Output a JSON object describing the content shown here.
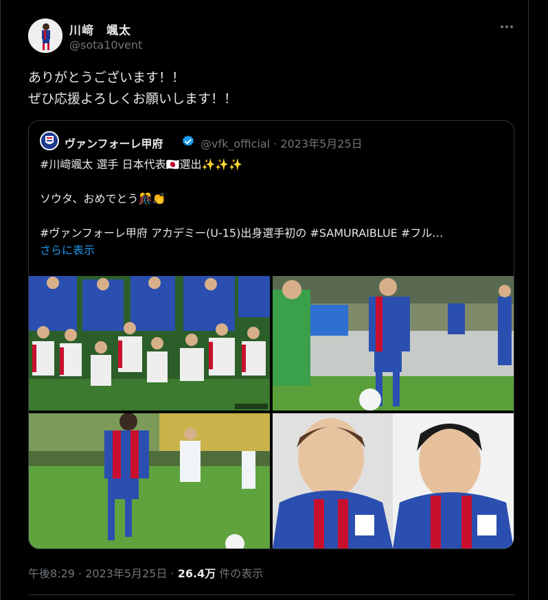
{
  "post": {
    "author_name": "川﨑　颯太",
    "author_handle": "@sota10vent",
    "more_icon": "more-icon",
    "lines": [
      "ありがとうございます！！",
      "ぜひ応援よろしくお願いします！！"
    ]
  },
  "quote": {
    "author_name": "ヴァンフォーレ甲府",
    "author_handle": "@vfk_official",
    "separator": "·",
    "date": "2023年5月25日",
    "line1": "#川﨑颯太 選手 日本代表🇯🇵選出✨✨✨",
    "line2": "ソウタ、おめでとう🎊👏",
    "line3": "#ヴァンフォーレ甲府 アカデミー(U-15)出身選手初の #SAMURAIBLUE #フル…",
    "show_more": "さらに表示"
  },
  "footer": {
    "time": "午後8:29 · 2023年5月25日 · ",
    "views": "26.4万",
    "views_label": " 件の表示"
  },
  "colors": {
    "background": "#000000",
    "text": "#e7e9ea",
    "muted": "#71767b",
    "link": "#1d9bf0",
    "border": "#2f3336",
    "team_blue": "#1d3a8f",
    "team_red": "#c8102e"
  }
}
